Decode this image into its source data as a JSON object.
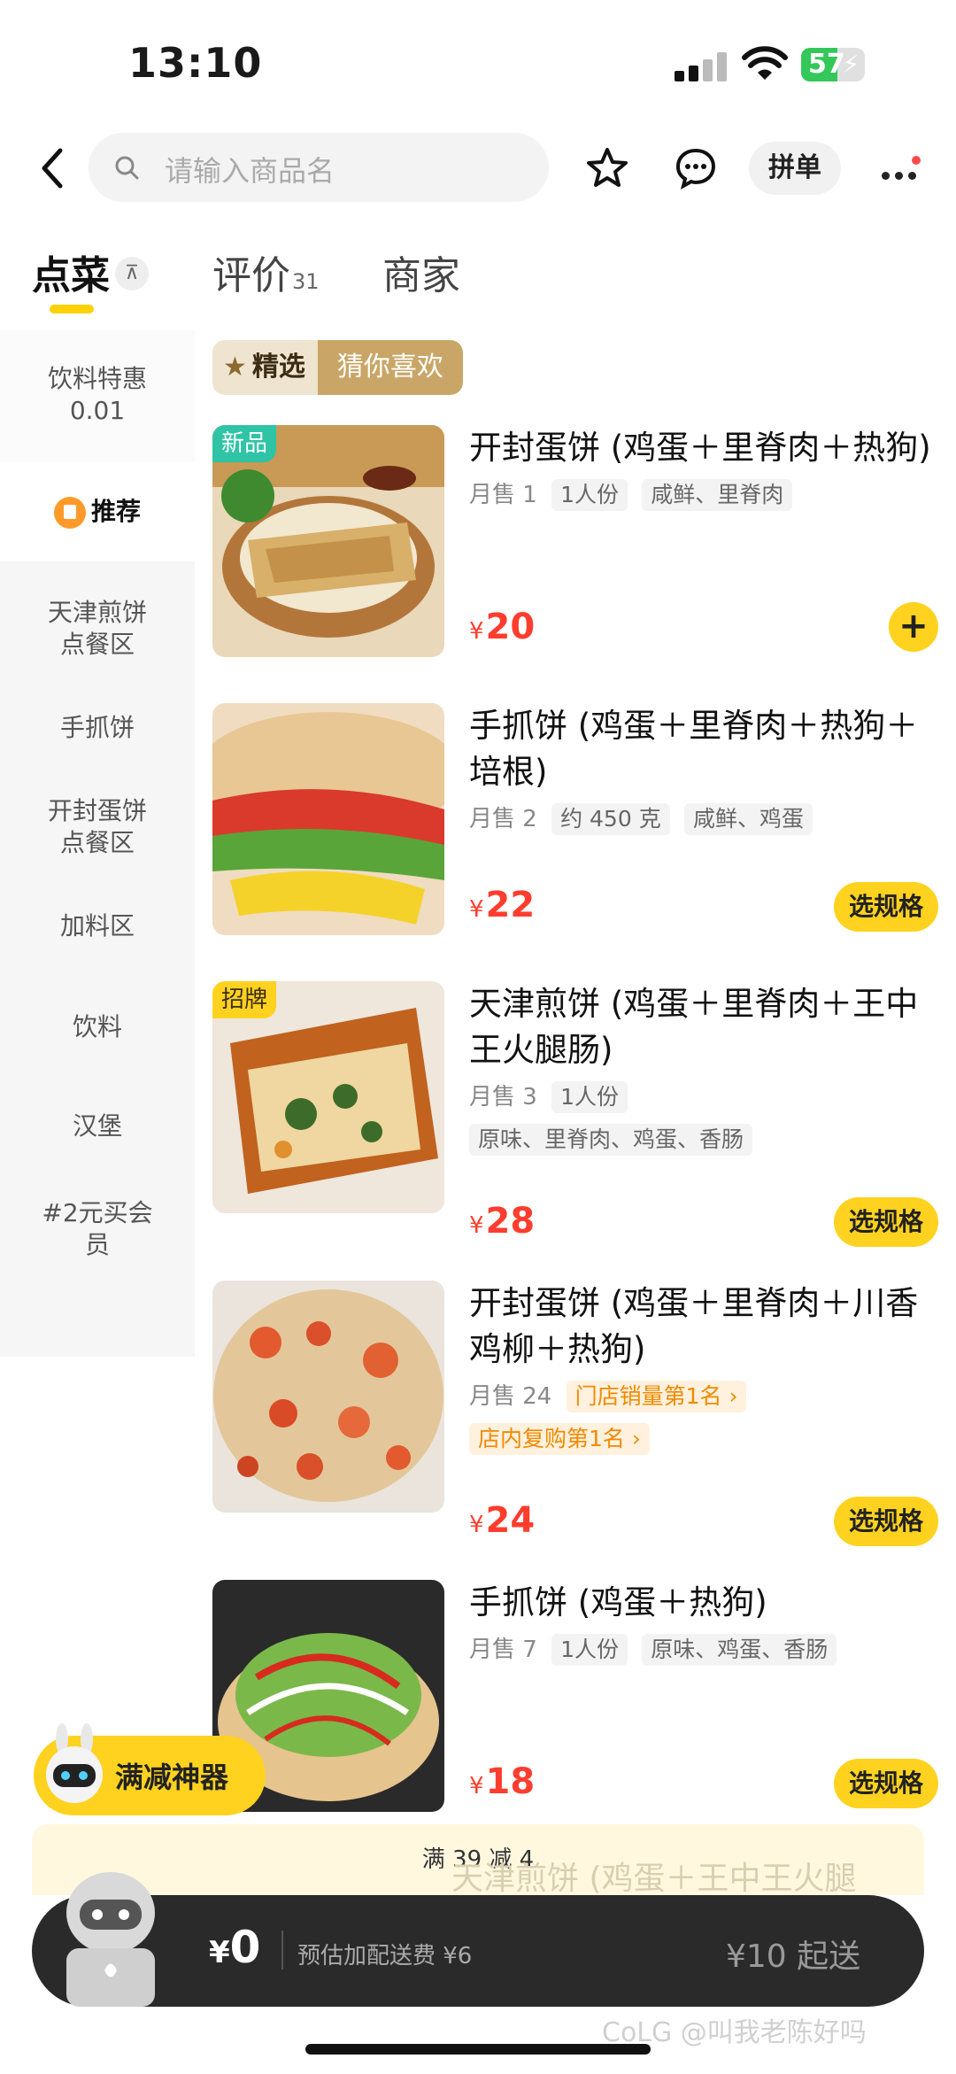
{
  "status_bar": {
    "time": "13:10",
    "battery": "57"
  },
  "nav": {
    "search_placeholder": "请输入商品名",
    "group_order": "拼单"
  },
  "tabs": [
    {
      "label": "点菜",
      "count": ""
    },
    {
      "label": "评价",
      "count": "31"
    },
    {
      "label": "商家",
      "count": ""
    }
  ],
  "collapse_icon_text": "⊼",
  "sidebar": {
    "promo": {
      "line1": "饮料特惠",
      "line2": "0.01"
    },
    "recommended": "推荐",
    "items": [
      {
        "line1": "天津煎饼",
        "line2": "点餐区"
      },
      {
        "line1": "手抓饼",
        "line2": ""
      },
      {
        "line1": "开封蛋饼",
        "line2": "点餐区"
      },
      {
        "line1": "加料区",
        "line2": ""
      },
      {
        "line1": "饮料",
        "line2": ""
      },
      {
        "line1": "汉堡",
        "line2": ""
      },
      {
        "line1": "#2元买会",
        "line2": "员"
      }
    ]
  },
  "filter": {
    "selected": "精选",
    "guess": "猜你喜欢"
  },
  "products": [
    {
      "badge": "新品",
      "title": "开封蛋饼 (鸡蛋＋里脊肉＋热狗)",
      "sales": "月售 1",
      "tags": [
        "1人份",
        "咸鲜、里脊肉"
      ],
      "currency": "¥",
      "price": "20",
      "action": "+"
    },
    {
      "badge": "",
      "title": "手抓饼 (鸡蛋＋里脊肉＋热狗＋培根)",
      "sales": "月售 2",
      "tags": [
        "约 450 克",
        "咸鲜、鸡蛋"
      ],
      "currency": "¥",
      "price": "22",
      "action": "选规格"
    },
    {
      "badge": "招牌",
      "title": "天津煎饼 (鸡蛋＋里脊肉＋王中王火腿肠)",
      "sales": "月售 3",
      "tags": [
        "1人份"
      ],
      "tags2": [
        "原味、里脊肉、鸡蛋、香肠"
      ],
      "currency": "¥",
      "price": "28",
      "action": "选规格"
    },
    {
      "badge": "",
      "title": "开封蛋饼 (鸡蛋＋里脊肉＋川香鸡柳＋热狗)",
      "sales": "月售 24",
      "rank_tags": [
        "门店销量第1名 ›"
      ],
      "rank_tags2": [
        "店内复购第1名 ›"
      ],
      "currency": "¥",
      "price": "24",
      "action": "选规格"
    },
    {
      "badge": "",
      "title": "手抓饼 (鸡蛋＋热狗)",
      "sales": "月售 7",
      "tags": [
        "1人份",
        "原味、鸡蛋、香肠"
      ],
      "currency": "¥",
      "price": "18",
      "action": "选规格"
    }
  ],
  "ghost_next_title": "天津煎饼 (鸡蛋＋王中王火腿",
  "robot_pill": "满减神器",
  "discount_tip": "满 39 减 4",
  "cart": {
    "currency": "¥",
    "amount": "0",
    "fee": "预估加配送费 ¥6",
    "min_order": "¥10 起送"
  },
  "watermark": "CoLG @叫我老陈好吗",
  "colors": {
    "accent": "#ffd21f",
    "price": "#ff3d2e",
    "cart_bg": "#2a2a2a"
  }
}
